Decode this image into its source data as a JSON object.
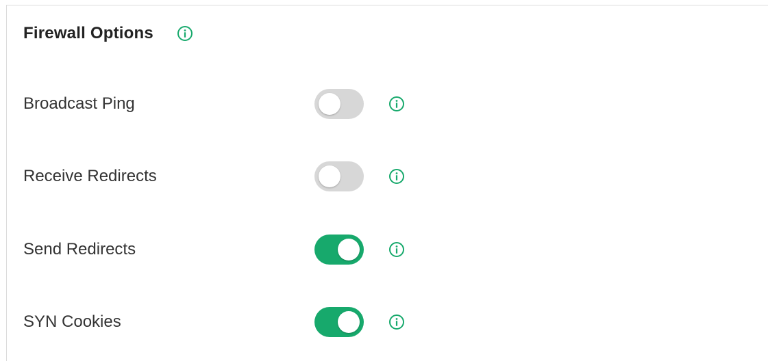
{
  "section": {
    "title": "Firewall Options"
  },
  "colors": {
    "accent": "#17a96c",
    "toggle_off": "#d7d7d7"
  },
  "options": [
    {
      "label": "Broadcast Ping",
      "enabled": false
    },
    {
      "label": "Receive Redirects",
      "enabled": false
    },
    {
      "label": "Send Redirects",
      "enabled": true
    },
    {
      "label": "SYN Cookies",
      "enabled": true
    }
  ],
  "icons": {
    "info": "info-circle-icon"
  }
}
